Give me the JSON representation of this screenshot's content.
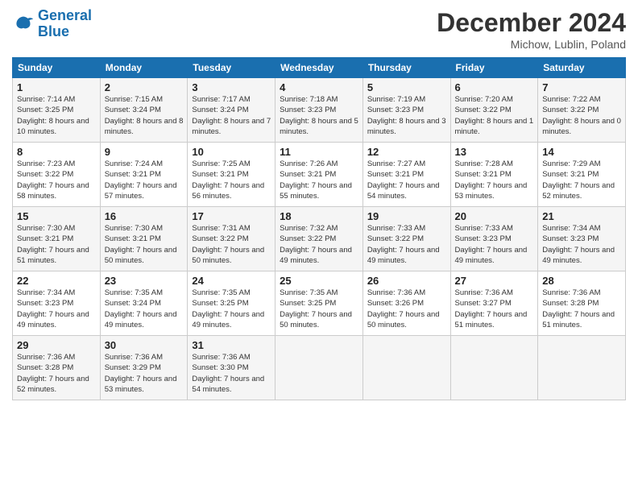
{
  "logo": {
    "line1": "General",
    "line2": "Blue"
  },
  "title": "December 2024",
  "location": "Michow, Lublin, Poland",
  "days_of_week": [
    "Sunday",
    "Monday",
    "Tuesday",
    "Wednesday",
    "Thursday",
    "Friday",
    "Saturday"
  ],
  "weeks": [
    [
      {
        "day": "1",
        "sunrise": "Sunrise: 7:14 AM",
        "sunset": "Sunset: 3:25 PM",
        "daylight": "Daylight: 8 hours and 10 minutes."
      },
      {
        "day": "2",
        "sunrise": "Sunrise: 7:15 AM",
        "sunset": "Sunset: 3:24 PM",
        "daylight": "Daylight: 8 hours and 8 minutes."
      },
      {
        "day": "3",
        "sunrise": "Sunrise: 7:17 AM",
        "sunset": "Sunset: 3:24 PM",
        "daylight": "Daylight: 8 hours and 7 minutes."
      },
      {
        "day": "4",
        "sunrise": "Sunrise: 7:18 AM",
        "sunset": "Sunset: 3:23 PM",
        "daylight": "Daylight: 8 hours and 5 minutes."
      },
      {
        "day": "5",
        "sunrise": "Sunrise: 7:19 AM",
        "sunset": "Sunset: 3:23 PM",
        "daylight": "Daylight: 8 hours and 3 minutes."
      },
      {
        "day": "6",
        "sunrise": "Sunrise: 7:20 AM",
        "sunset": "Sunset: 3:22 PM",
        "daylight": "Daylight: 8 hours and 1 minute."
      },
      {
        "day": "7",
        "sunrise": "Sunrise: 7:22 AM",
        "sunset": "Sunset: 3:22 PM",
        "daylight": "Daylight: 8 hours and 0 minutes."
      }
    ],
    [
      {
        "day": "8",
        "sunrise": "Sunrise: 7:23 AM",
        "sunset": "Sunset: 3:22 PM",
        "daylight": "Daylight: 7 hours and 58 minutes."
      },
      {
        "day": "9",
        "sunrise": "Sunrise: 7:24 AM",
        "sunset": "Sunset: 3:21 PM",
        "daylight": "Daylight: 7 hours and 57 minutes."
      },
      {
        "day": "10",
        "sunrise": "Sunrise: 7:25 AM",
        "sunset": "Sunset: 3:21 PM",
        "daylight": "Daylight: 7 hours and 56 minutes."
      },
      {
        "day": "11",
        "sunrise": "Sunrise: 7:26 AM",
        "sunset": "Sunset: 3:21 PM",
        "daylight": "Daylight: 7 hours and 55 minutes."
      },
      {
        "day": "12",
        "sunrise": "Sunrise: 7:27 AM",
        "sunset": "Sunset: 3:21 PM",
        "daylight": "Daylight: 7 hours and 54 minutes."
      },
      {
        "day": "13",
        "sunrise": "Sunrise: 7:28 AM",
        "sunset": "Sunset: 3:21 PM",
        "daylight": "Daylight: 7 hours and 53 minutes."
      },
      {
        "day": "14",
        "sunrise": "Sunrise: 7:29 AM",
        "sunset": "Sunset: 3:21 PM",
        "daylight": "Daylight: 7 hours and 52 minutes."
      }
    ],
    [
      {
        "day": "15",
        "sunrise": "Sunrise: 7:30 AM",
        "sunset": "Sunset: 3:21 PM",
        "daylight": "Daylight: 7 hours and 51 minutes."
      },
      {
        "day": "16",
        "sunrise": "Sunrise: 7:30 AM",
        "sunset": "Sunset: 3:21 PM",
        "daylight": "Daylight: 7 hours and 50 minutes."
      },
      {
        "day": "17",
        "sunrise": "Sunrise: 7:31 AM",
        "sunset": "Sunset: 3:22 PM",
        "daylight": "Daylight: 7 hours and 50 minutes."
      },
      {
        "day": "18",
        "sunrise": "Sunrise: 7:32 AM",
        "sunset": "Sunset: 3:22 PM",
        "daylight": "Daylight: 7 hours and 49 minutes."
      },
      {
        "day": "19",
        "sunrise": "Sunrise: 7:33 AM",
        "sunset": "Sunset: 3:22 PM",
        "daylight": "Daylight: 7 hours and 49 minutes."
      },
      {
        "day": "20",
        "sunrise": "Sunrise: 7:33 AM",
        "sunset": "Sunset: 3:23 PM",
        "daylight": "Daylight: 7 hours and 49 minutes."
      },
      {
        "day": "21",
        "sunrise": "Sunrise: 7:34 AM",
        "sunset": "Sunset: 3:23 PM",
        "daylight": "Daylight: 7 hours and 49 minutes."
      }
    ],
    [
      {
        "day": "22",
        "sunrise": "Sunrise: 7:34 AM",
        "sunset": "Sunset: 3:23 PM",
        "daylight": "Daylight: 7 hours and 49 minutes."
      },
      {
        "day": "23",
        "sunrise": "Sunrise: 7:35 AM",
        "sunset": "Sunset: 3:24 PM",
        "daylight": "Daylight: 7 hours and 49 minutes."
      },
      {
        "day": "24",
        "sunrise": "Sunrise: 7:35 AM",
        "sunset": "Sunset: 3:25 PM",
        "daylight": "Daylight: 7 hours and 49 minutes."
      },
      {
        "day": "25",
        "sunrise": "Sunrise: 7:35 AM",
        "sunset": "Sunset: 3:25 PM",
        "daylight": "Daylight: 7 hours and 50 minutes."
      },
      {
        "day": "26",
        "sunrise": "Sunrise: 7:36 AM",
        "sunset": "Sunset: 3:26 PM",
        "daylight": "Daylight: 7 hours and 50 minutes."
      },
      {
        "day": "27",
        "sunrise": "Sunrise: 7:36 AM",
        "sunset": "Sunset: 3:27 PM",
        "daylight": "Daylight: 7 hours and 51 minutes."
      },
      {
        "day": "28",
        "sunrise": "Sunrise: 7:36 AM",
        "sunset": "Sunset: 3:28 PM",
        "daylight": "Daylight: 7 hours and 51 minutes."
      }
    ],
    [
      {
        "day": "29",
        "sunrise": "Sunrise: 7:36 AM",
        "sunset": "Sunset: 3:28 PM",
        "daylight": "Daylight: 7 hours and 52 minutes."
      },
      {
        "day": "30",
        "sunrise": "Sunrise: 7:36 AM",
        "sunset": "Sunset: 3:29 PM",
        "daylight": "Daylight: 7 hours and 53 minutes."
      },
      {
        "day": "31",
        "sunrise": "Sunrise: 7:36 AM",
        "sunset": "Sunset: 3:30 PM",
        "daylight": "Daylight: 7 hours and 54 minutes."
      },
      null,
      null,
      null,
      null
    ]
  ]
}
